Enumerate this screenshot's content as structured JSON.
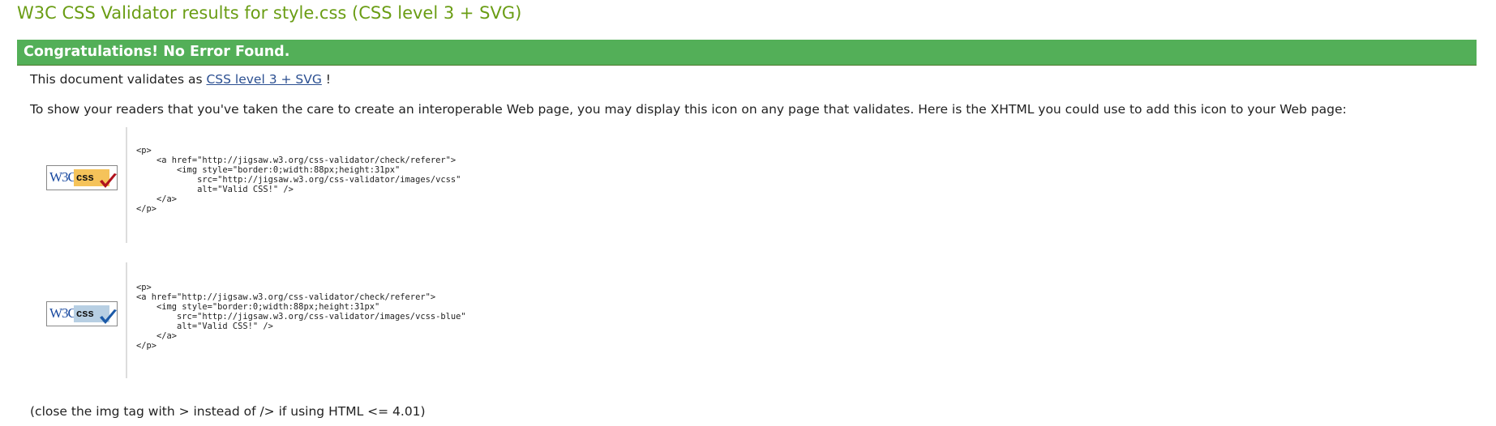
{
  "page_title": "W3C CSS Validator results for style.css (CSS level 3 + SVG)",
  "banner": "Congratulations! No Error Found.",
  "validates": {
    "prefix": "This document validates as ",
    "link": "CSS level 3 + SVG",
    "suffix": " !"
  },
  "intro": "To show your readers that you've taken the care to create an interoperable Web page, you may display this icon on any page that validates. Here is the XHTML you could use to add this icon to your Web page:",
  "badges": [
    {
      "w3c": "W3C",
      "css": "css",
      "color": "#f5c35a",
      "check_color": "#b0121d",
      "code": "<p>\n    <a href=\"http://jigsaw.w3.org/css-validator/check/referer\">\n        <img style=\"border:0;width:88px;height:31px\"\n            src=\"http://jigsaw.w3.org/css-validator/images/vcss\"\n            alt=\"Valid CSS!\" />\n    </a>\n</p>"
    },
    {
      "w3c": "W3C",
      "css": "css",
      "color": "#b7cfe3",
      "check_color": "#1c5aa8",
      "code": "<p>\n<a href=\"http://jigsaw.w3.org/css-validator/check/referer\">\n    <img style=\"border:0;width:88px;height:31px\"\n        src=\"http://jigsaw.w3.org/css-validator/images/vcss-blue\"\n        alt=\"Valid CSS!\" />\n    </a>\n</p>"
    }
  ],
  "footer_note": "(close the img tag with > instead of /> if using HTML <= 4.01)"
}
